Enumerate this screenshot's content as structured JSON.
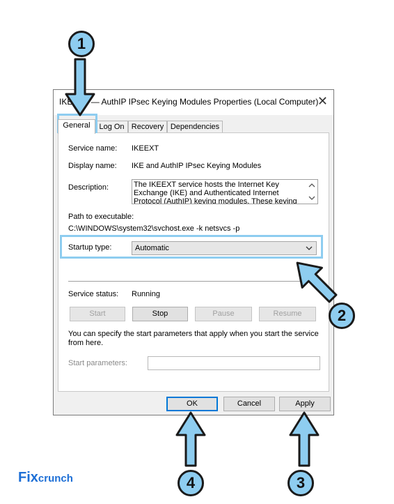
{
  "dialog": {
    "title": "IKEEXT — AuthIP IPsec Keying Modules Properties (Local Computer)",
    "close_glyph": "✕",
    "tabs": [
      {
        "label": "General"
      },
      {
        "label": "Log On"
      },
      {
        "label": "Recovery"
      },
      {
        "label": "Dependencies"
      }
    ],
    "general": {
      "service_name_label": "Service name:",
      "service_name_value": "IKEEXT",
      "display_name_label": "Display name:",
      "display_name_value": "IKE and AuthIP IPsec Keying Modules",
      "description_label": "Description:",
      "description_value": "The IKEEXT service hosts the Internet Key Exchange (IKE) and Authenticated Internet Protocol (AuthIP) keying modules. These keying modules are",
      "path_label": "Path to executable:",
      "path_value": "C:\\WINDOWS\\system32\\svchost.exe -k netsvcs -p",
      "startup_type_label": "Startup type:",
      "startup_type_value": "Automatic",
      "service_status_label": "Service status:",
      "service_status_value": "Running",
      "buttons": {
        "start": "Start",
        "stop": "Stop",
        "pause": "Pause",
        "resume": "Resume"
      },
      "help_text": "You can specify the start parameters that apply when you start the service from here.",
      "start_params_label": "Start parameters:",
      "start_params_value": ""
    },
    "footer": {
      "ok": "OK",
      "cancel": "Cancel",
      "apply": "Apply"
    }
  },
  "annotations": {
    "badges": [
      "1",
      "2",
      "3",
      "4"
    ],
    "highlight_color": "#8ecdf0"
  },
  "logo": {
    "part1": "Fix",
    "part2": "crunch",
    "color": "#1d6fd6"
  }
}
